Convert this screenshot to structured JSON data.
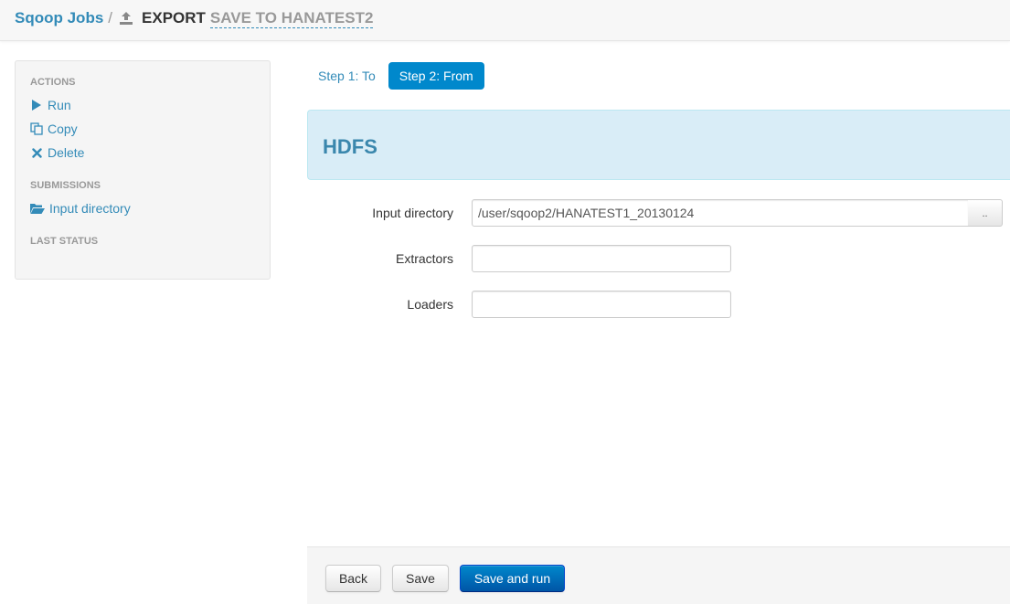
{
  "header": {
    "breadcrumb_root": "Sqoop Jobs",
    "separator": "/",
    "job_type": "EXPORT",
    "job_name": "SAVE TO HANATEST2"
  },
  "sidebar": {
    "actions_header": "ACTIONS",
    "actions": [
      {
        "label": "Run",
        "icon": "play-icon"
      },
      {
        "label": "Copy",
        "icon": "copy-icon"
      },
      {
        "label": "Delete",
        "icon": "close-icon"
      }
    ],
    "submissions_header": "SUBMISSIONS",
    "submissions": [
      {
        "label": "Input directory",
        "icon": "folder-open-icon"
      }
    ],
    "last_status_header": "LAST STATUS"
  },
  "steps": [
    {
      "label": "Step 1: To",
      "active": false
    },
    {
      "label": "Step 2: From",
      "active": true
    }
  ],
  "panel": {
    "title": "HDFS"
  },
  "form": {
    "input_directory": {
      "label": "Input directory",
      "value": "/user/sqoop2/HANATEST1_20130124"
    },
    "browse_label": "..",
    "extractors": {
      "label": "Extractors",
      "value": ""
    },
    "loaders": {
      "label": "Loaders",
      "value": ""
    }
  },
  "footer": {
    "back_label": "Back",
    "save_label": "Save",
    "save_run_label": "Save and run"
  },
  "colors": {
    "link": "#338bb8",
    "primary": "#0088cc",
    "panel_bg": "#d9edf7",
    "panel_title": "#3a87ad"
  }
}
